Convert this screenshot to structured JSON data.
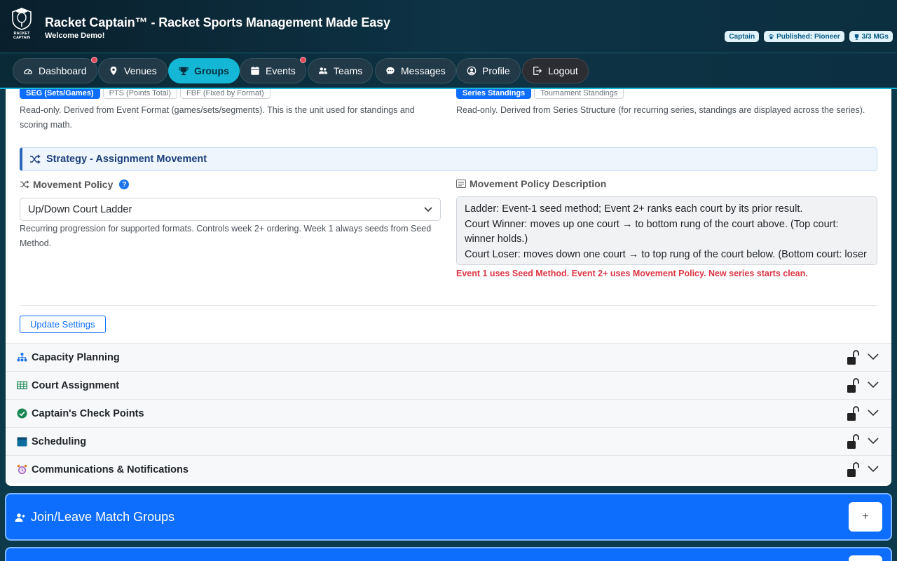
{
  "header": {
    "title": "Racket Captain™ - Racket Sports Management Made Easy",
    "welcome": "Welcome Demo!",
    "logo_text": "RACKET CAPTAIN",
    "badges": [
      {
        "label": "Captain",
        "icon": "none"
      },
      {
        "label": "Published: Pioneer",
        "icon": "paw-icon"
      },
      {
        "label": "3/3 MGs",
        "icon": "trophy-icon"
      }
    ]
  },
  "nav": {
    "items": [
      {
        "label": "Dashboard",
        "icon": "gauge-icon",
        "notify": true
      },
      {
        "label": "Venues",
        "icon": "map-pin-icon",
        "notify": false
      },
      {
        "label": "Groups",
        "icon": "trophy-icon",
        "active": true
      },
      {
        "label": "Events",
        "icon": "calendar-icon",
        "notify": true
      },
      {
        "label": "Teams",
        "icon": "people-icon",
        "notify": false
      },
      {
        "label": "Messages",
        "icon": "chat-icon",
        "notify": false
      },
      {
        "label": "Profile",
        "icon": "person-circle-icon",
        "notify": false
      },
      {
        "label": "Logout",
        "icon": "logout-icon",
        "notify": false
      }
    ]
  },
  "scoring": {
    "options": [
      "SEG (Sets/Games)",
      "PTS (Points Total)",
      "FBF (Fixed by Format)"
    ],
    "selected": "SEG (Sets/Games)",
    "help": "Read-only. Derived from Event Format (games/sets/segments). This is the unit used for standings and scoring math."
  },
  "standings": {
    "options": [
      "Series Standings",
      "Tournament Standings"
    ],
    "selected": "Series Standings",
    "help": "Read-only. Derived from Series Structure (for recurring series, standings are displayed across the series)."
  },
  "strategy": {
    "title": "Strategy - Assignment Movement",
    "policy_label": "Movement Policy",
    "policy_value": "Up/Down Court Ladder",
    "policy_help": "Recurring progression for supported formats. Controls week 2+ ordering. Week 1 always seeds from Seed Method.",
    "desc_label": "Movement Policy Description",
    "desc_lines": [
      "Ladder: Event-1 seed method; Event 2+ ranks each court by its prior result.",
      "Court Winner: moves up one court → to bottom rung of the court above. (Top court: winner holds.)",
      "Court Loser: moves down one court → to top rung of the court below. (Bottom court: loser"
    ],
    "warning": "Event 1 uses Seed Method. Event 2+ uses Movement Policy. New series starts clean.",
    "update_label": "Update Settings"
  },
  "sections": [
    {
      "label": "Capacity Planning",
      "icon": "sitemap-icon",
      "color": "#1a73e8"
    },
    {
      "label": "Court Assignment",
      "icon": "grid-icon",
      "color": "#198754"
    },
    {
      "label": "Captain's Check Points",
      "icon": "check-circle-icon",
      "color": "#198754"
    },
    {
      "label": "Scheduling",
      "icon": "calendar-icon",
      "color": "#0d6e9e"
    },
    {
      "label": "Communications & Notifications",
      "icon": "alarm-clock-icon",
      "color": "#9b59b6"
    }
  ],
  "join_leave": {
    "title": "Join/Leave Match Groups",
    "button": "+"
  }
}
